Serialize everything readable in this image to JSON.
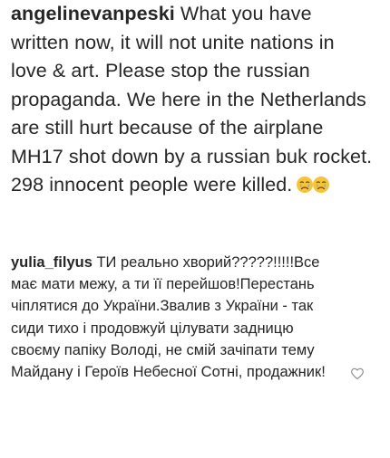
{
  "comments": [
    {
      "username": "angelinevanpeski",
      "text": "What you have written now, it will not unite nations in love & art. Please stop the russian propaganda. We here in the Netherlands are still hurt because of the airplane MH17 shot down by a russian buk rocket. 298 innocent people were killed.",
      "emojis": [
        "crying-face",
        "crying-face"
      ],
      "liked": false
    },
    {
      "username": "yulia_filyus",
      "text": "ТИ реально хворий?????!!!!!Все має мати межу, а ти її перейшов!Перестань чіплятися до України.Звалив з України - так сиди тихо і продовжуй цілувати задницю своєму папіку Володі, не смій зачіпати тему Майдану і Героїв Небесної Сотні, продажник!",
      "liked": false
    }
  ],
  "icons": {
    "like": "heart-outline-icon",
    "emoji": "crying-face"
  },
  "colors": {
    "text": "#262626",
    "heart_outline": "#8e8e8e",
    "emoji_face": "#f7c338",
    "emoji_tear": "#5aa9e6"
  }
}
